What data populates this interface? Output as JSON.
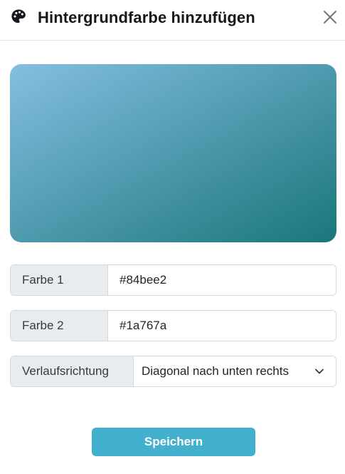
{
  "dialog": {
    "title": "Hintergrundfarbe hinzufügen",
    "icon": "palette-icon",
    "close_icon": "close-icon"
  },
  "preview": {
    "color_1": "#84bee2",
    "color_2": "#1a767a",
    "direction": "to bottom right"
  },
  "form": {
    "color1": {
      "label": "Farbe 1",
      "value": "#84bee2"
    },
    "color2": {
      "label": "Farbe 2",
      "value": "#1a767a"
    },
    "direction": {
      "label": "Verlaufsrichtung",
      "value": "Diagonal nach unten rechts",
      "icon": "chevron-down-icon"
    }
  },
  "actions": {
    "save_label": "Speichern",
    "save_color": "#43b0cd"
  }
}
